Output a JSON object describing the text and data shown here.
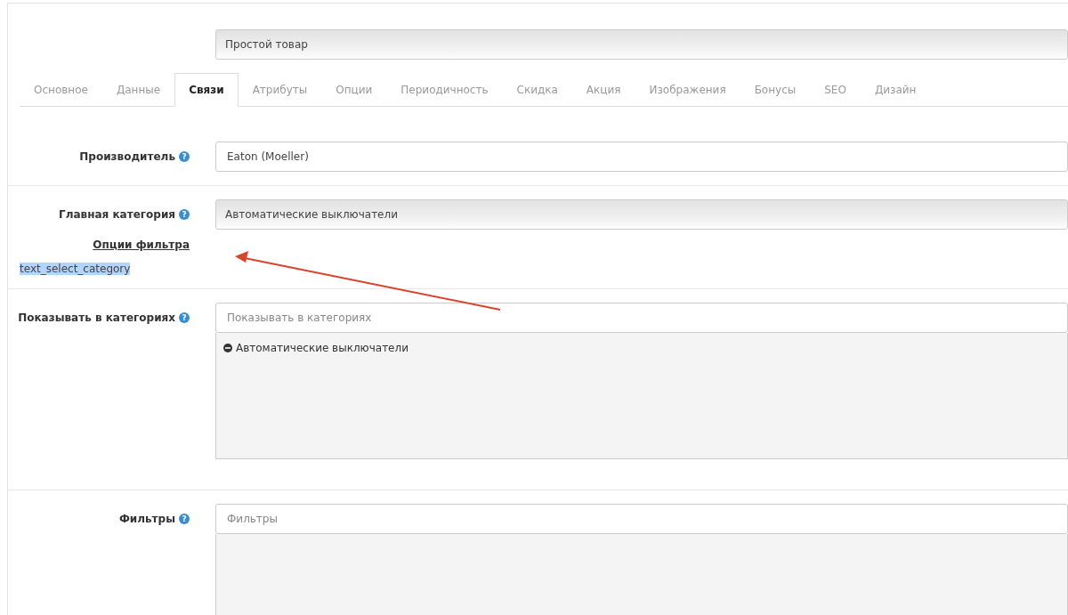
{
  "product_type": {
    "value": "Простой товар"
  },
  "tabs": [
    {
      "label": "Основное",
      "selected": false
    },
    {
      "label": "Данные",
      "selected": false
    },
    {
      "label": "Связи",
      "selected": true
    },
    {
      "label": "Атрибуты",
      "selected": false
    },
    {
      "label": "Опции",
      "selected": false
    },
    {
      "label": "Периодичность",
      "selected": false
    },
    {
      "label": "Скидка",
      "selected": false
    },
    {
      "label": "Акция",
      "selected": false
    },
    {
      "label": "Изображения",
      "selected": false
    },
    {
      "label": "Бонусы",
      "selected": false
    },
    {
      "label": "SEO",
      "selected": false
    },
    {
      "label": "Дизайн",
      "selected": false
    }
  ],
  "fields": [
    {
      "kind": "input",
      "label": "Производитель",
      "help": "?",
      "value": "Eaton (Moeller)"
    },
    {
      "kind": "select",
      "label": "Главная категория",
      "help": "?",
      "value": "Автоматические выключатели",
      "link": "Опции фильтра",
      "note": {
        "text": "text_select_category",
        "highlighted": true
      }
    },
    {
      "kind": "autocomplete",
      "label": "Показывать в категориях",
      "help": "?",
      "placeholder": "Показывать в категориях",
      "chosen": [
        "Автоматические выключатели"
      ]
    },
    {
      "kind": "autocomplete",
      "label": "Фильтры",
      "help": "?",
      "placeholder": "Фильтры"
    }
  ]
}
